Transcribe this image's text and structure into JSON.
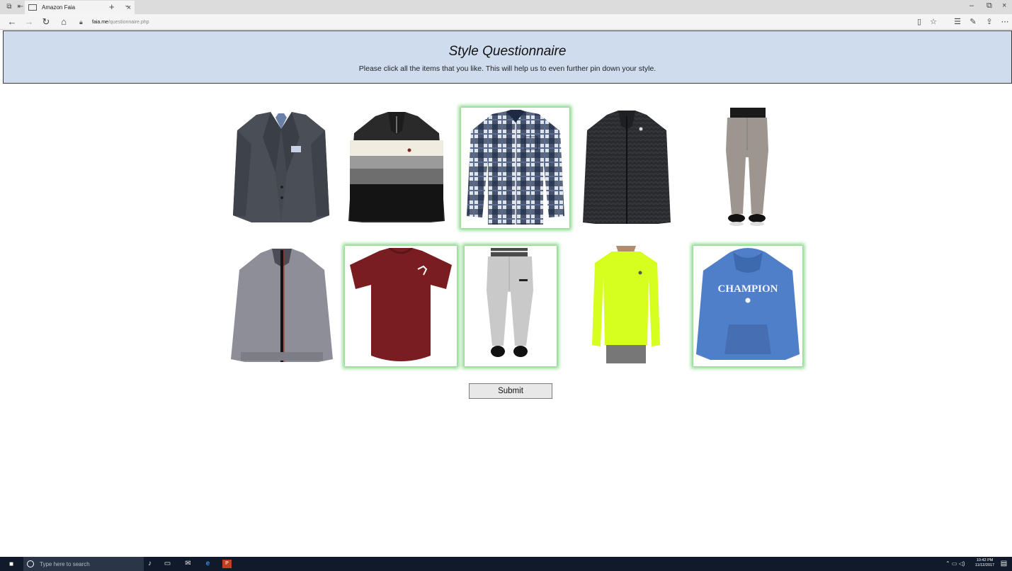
{
  "browser": {
    "tab_title": "Amazon Faia",
    "url_host": "faia.me",
    "url_path": "/questionnaire.php"
  },
  "page": {
    "title": "Style Questionnaire",
    "instructions": "Please click all the items that you like. This will help us to even further pin down your style.",
    "submit_label": "Submit"
  },
  "items": [
    {
      "name": "gray-tweed-blazer",
      "selected": false
    },
    {
      "name": "striped-quarter-zip-sweater",
      "selected": false
    },
    {
      "name": "navy-plaid-shirt",
      "selected": true
    },
    {
      "name": "black-knit-zip-cardigan",
      "selected": false
    },
    {
      "name": "gray-chino-pants",
      "selected": false
    },
    {
      "name": "heather-gray-track-jacket",
      "selected": false
    },
    {
      "name": "maroon-puma-tshirt",
      "selected": true
    },
    {
      "name": "light-gray-jogger-pants",
      "selected": true
    },
    {
      "name": "neon-yellow-long-sleeve-shirt",
      "selected": false
    },
    {
      "name": "blue-champion-hoodie",
      "selected": true
    }
  ],
  "item_text": {
    "hoodie_brand": "CHAMPION"
  },
  "taskbar": {
    "search_placeholder": "Type here to search",
    "time": "10:42 PM",
    "date": "11/12/2017"
  },
  "colors": {
    "header_bg": "#cfdced",
    "selection_glow": "#5fc85f"
  }
}
